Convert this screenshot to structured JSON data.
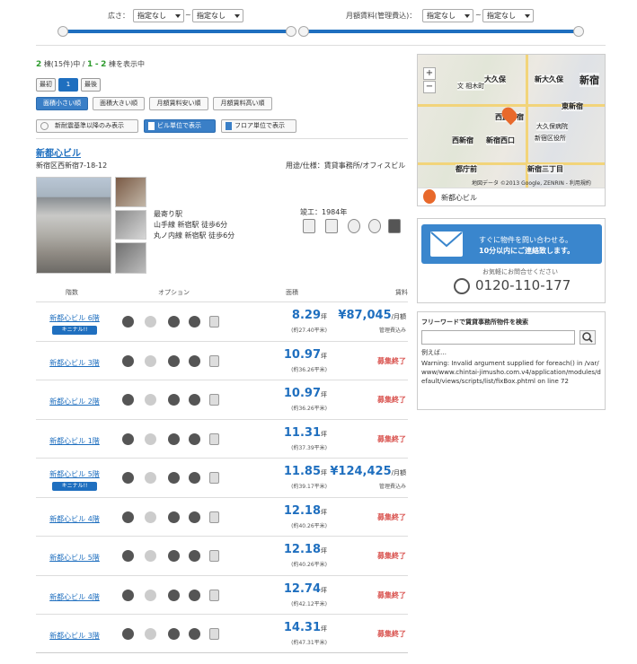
{
  "filters": {
    "area_label": "広さ：",
    "rent_label": "月額賃料(管理費込)：",
    "area_min": "指定なし",
    "area_max": "指定なし",
    "rent_min": "指定なし",
    "rent_max": "指定なし",
    "tilde": "~"
  },
  "results": {
    "total_buildings": "2",
    "total_units_text": "棟(15件)中 /",
    "range_start": "1",
    "range_sep": "-",
    "range_end": "2",
    "suffix": "棟を表示中"
  },
  "pager": {
    "first": "最初",
    "page": "1",
    "last": "最後"
  },
  "sort": [
    "面積小さい順",
    "面積大きい順",
    "月額賃料安い順",
    "月額賃料高い順"
  ],
  "view": [
    "新耐震基準以降のみ表示",
    "ビル単位で表示",
    "フロア単位で表示"
  ],
  "building": {
    "name": "新都心ビル",
    "address": "新宿区西新宿7-18-12",
    "usage": "用途/仕様：賃貸事務所/オフィスビル",
    "station_label": "最寄り駅",
    "access1": "山手線 新宿駅 徒歩6分",
    "access2": "丸ノ内線 新宿駅 徒歩6分",
    "built": "竣工：1984年"
  },
  "table": {
    "headers": {
      "floor": "階数",
      "options": "オプション",
      "area": "面積",
      "rent": "賃料"
    },
    "tsubo_unit": "坪",
    "rent_unit": "/月額",
    "rows": [
      {
        "name": "新都心ビル 6階",
        "badge": "キニナル!!",
        "area": "8.29",
        "sqm": "(約27.40平米)",
        "price": "¥87,045",
        "price_note": "管理費込み",
        "status": ""
      },
      {
        "name": "新都心ビル 3階",
        "badge": "",
        "area": "10.97",
        "sqm": "(約36.26平米)",
        "price": "",
        "price_note": "",
        "status": "募集終了"
      },
      {
        "name": "新都心ビル 2階",
        "badge": "",
        "area": "10.97",
        "sqm": "(約36.26平米)",
        "price": "",
        "price_note": "",
        "status": "募集終了"
      },
      {
        "name": "新都心ビル 1階",
        "badge": "",
        "area": "11.31",
        "sqm": "(約37.39平米)",
        "price": "",
        "price_note": "",
        "status": "募集終了"
      },
      {
        "name": "新都心ビル 5階",
        "badge": "キニナル!!",
        "area": "11.85",
        "sqm": "(約39.17平米)",
        "price": "¥124,425",
        "price_note": "管理費込み",
        "status": ""
      },
      {
        "name": "新都心ビル 4階",
        "badge": "",
        "area": "12.18",
        "sqm": "(約40.26平米)",
        "price": "",
        "price_note": "",
        "status": "募集終了"
      },
      {
        "name": "新都心ビル 5階",
        "badge": "",
        "area": "12.18",
        "sqm": "(約40.26平米)",
        "price": "",
        "price_note": "",
        "status": "募集終了"
      },
      {
        "name": "新都心ビル 4階",
        "badge": "",
        "area": "12.74",
        "sqm": "(約42.12平米)",
        "price": "",
        "price_note": "",
        "status": "募集終了"
      },
      {
        "name": "新都心ビル 3階",
        "badge": "",
        "area": "14.31",
        "sqm": "(約47.31平米)",
        "price": "",
        "price_note": "",
        "status": "募集終了"
      }
    ]
  },
  "map": {
    "labels": [
      "大久保",
      "新大久保",
      "新宿",
      "東新宿",
      "西武新宿",
      "大久保病院",
      "西新宿",
      "新宿西口",
      "新宿区役所",
      "都庁前",
      "新宿三丁目",
      "文 相木町"
    ],
    "attribution": "地図データ ©2013 Google, ZENRIN - 利用規約",
    "pin_label": "新都心ビル",
    "zoom_in": "+",
    "zoom_out": "−"
  },
  "contact": {
    "line1": "すぐに物件を問い合わせる。",
    "line2": "10分以内にご連絡致します。",
    "note": "お気軽にお問合せください",
    "phone": "0120-110-177"
  },
  "search": {
    "title": "フリーワードで賃貸事務所物件を検索",
    "example": "例えば…",
    "warning": "Warning: Invalid argument supplied for foreach() in /var/www/www.chintai-jimusho.com.v4/application/modules/default/views/scripts/list/fixBox.phtml on line 72"
  },
  "colors": {
    "accent": "#1f6fbf",
    "closed": "#d9534f",
    "green": "#2e9b2e"
  }
}
